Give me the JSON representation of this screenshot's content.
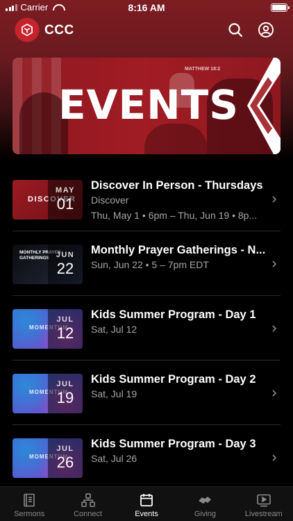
{
  "status_bar": {
    "carrier": "Carrier",
    "time": "8:16 AM"
  },
  "header": {
    "app_name": "CCC"
  },
  "banner": {
    "title": "EVENTS",
    "sign_text": "MATTHEW 18:2"
  },
  "events": [
    {
      "title": "Discover In Person  - Thursdays",
      "subtitle": "Discover",
      "detail": "Thu, May 1 • 6pm – Thu, Jun 19 • 8p...",
      "month": "MAY",
      "day": "01",
      "thumb_text": "DISCOVER"
    },
    {
      "title": "Monthly Prayer Gatherings - N...",
      "subtitle": "Sun, Jun 22 • 5 – 7pm EDT",
      "month": "JUN",
      "day": "22",
      "thumb_text": "MONTHLY PRAYER GATHERINGS"
    },
    {
      "title": "Kids Summer Program - Day 1",
      "subtitle": "Sat, Jul 12",
      "month": "JUL",
      "day": "12",
      "thumb_text": "MOMENTUM"
    },
    {
      "title": "Kids Summer Program - Day 2",
      "subtitle": "Sat, Jul 19",
      "month": "JUL",
      "day": "19",
      "thumb_text": "MOMENTUM"
    },
    {
      "title": "Kids Summer Program - Day 3",
      "subtitle": "Sat, Jul 26",
      "month": "JUL",
      "day": "26",
      "thumb_text": "MOMENTUM"
    }
  ],
  "tabs": [
    {
      "label": "Sermons",
      "icon": "book-icon",
      "active": false
    },
    {
      "label": "Connect",
      "icon": "network-icon",
      "active": false
    },
    {
      "label": "Events",
      "icon": "calendar-icon",
      "active": true
    },
    {
      "label": "Giving",
      "icon": "handshake-icon",
      "active": false
    },
    {
      "label": "Livestream",
      "icon": "play-screen-icon",
      "active": false
    }
  ],
  "colors": {
    "brand": "#c8232c",
    "banner": "#a11c24",
    "background": "#000000",
    "muted_text": "#a6a6a6"
  }
}
